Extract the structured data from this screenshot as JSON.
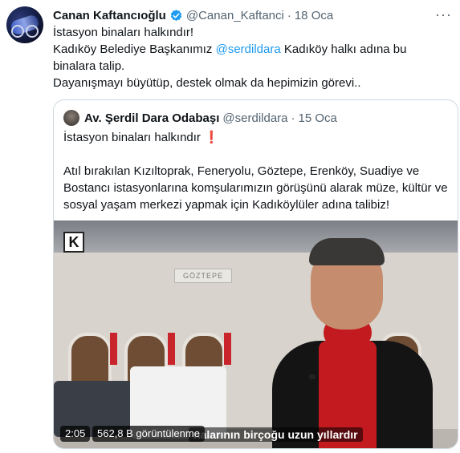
{
  "tweet": {
    "author_name": "Canan Kaftancıoğlu",
    "handle": "@Canan_Kaftanci",
    "separator": "·",
    "date": "18 Oca",
    "more": "···",
    "lines": {
      "l1": "İstasyon binaları halkındır!",
      "l2_pre": "Kadıköy Belediye Başkanımız ",
      "l2_mention": "@serdildara",
      "l2_post": " Kadıköy halkı adına bu binalara talip.",
      "l3": "Dayanışmayı büyütüp, destek olmak da hepimizin görevi.."
    }
  },
  "quote": {
    "author_name": "Av. Şerdil Dara Odabaşı",
    "handle": "@serdildara",
    "separator": "·",
    "date": "15 Oca",
    "line1": "İstasyon binaları halkındır",
    "exclaim": "❗",
    "paragraph": "Atıl bırakılan Kızıltoprak, Feneryolu, Göztepe, Erenköy, Suadiye ve Bostancı istasyonlarına komşularımızın görüşünü alarak müze, kültür ve sosyal yaşam merkezi yapmak için Kadıköylüler adına talibiz!"
  },
  "video": {
    "logo_letter": "K",
    "station_sign": "GÖZTEPE",
    "duration": "2:05",
    "views": "562,8 B görüntülenme",
    "caption": "nalarının birçoğu uzun yıllardır"
  },
  "colors": {
    "accent": "#1d9bf0",
    "verified": "#1d9bf0",
    "muted": "#536471",
    "border": "#cfd9de",
    "sweater": "#c21a1f"
  },
  "icons": {
    "verified": "verified-badge-icon",
    "more": "more-options-icon",
    "logo": "kadikoy-logo"
  }
}
